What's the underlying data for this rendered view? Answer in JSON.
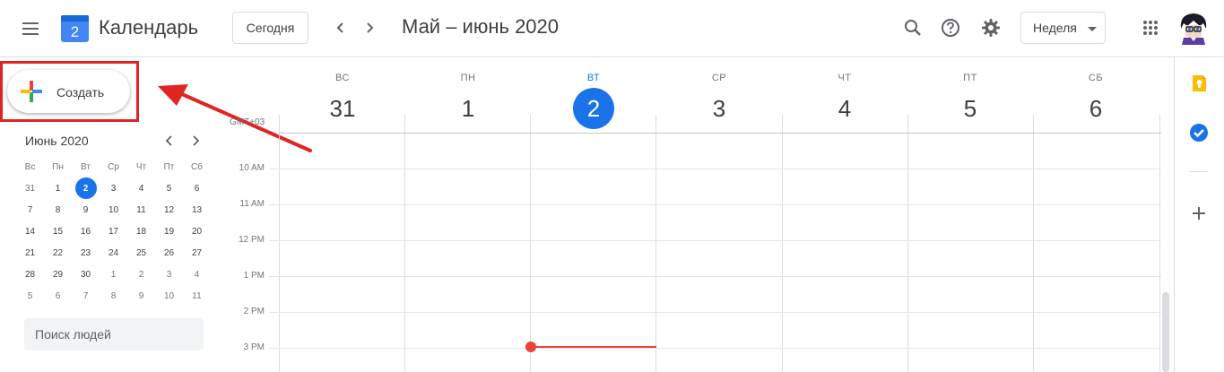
{
  "header": {
    "app_title": "Календарь",
    "logo_day": "2",
    "today_button": "Сегодня",
    "date_range": "Май – июнь 2020",
    "view_select": "Неделя"
  },
  "sidebar": {
    "create_label": "Создать",
    "mini_calendar": {
      "title": "Июнь 2020",
      "weekdays": [
        "Вс",
        "Пн",
        "Вт",
        "Ср",
        "Чт",
        "Пт",
        "Сб"
      ],
      "weeks": [
        [
          "31",
          "1",
          "2",
          "3",
          "4",
          "5",
          "6"
        ],
        [
          "7",
          "8",
          "9",
          "10",
          "11",
          "12",
          "13"
        ],
        [
          "14",
          "15",
          "16",
          "17",
          "18",
          "19",
          "20"
        ],
        [
          "21",
          "22",
          "23",
          "24",
          "25",
          "26",
          "27"
        ],
        [
          "28",
          "29",
          "30",
          "1",
          "2",
          "3",
          "4"
        ],
        [
          "5",
          "6",
          "7",
          "8",
          "9",
          "10",
          "11"
        ]
      ],
      "today": "2"
    },
    "people_search_placeholder": "Поиск людей"
  },
  "week": {
    "timezone": "GMT+03",
    "days": [
      {
        "dow": "ВС",
        "num": "31",
        "today": false
      },
      {
        "dow": "ПН",
        "num": "1",
        "today": false
      },
      {
        "dow": "ВТ",
        "num": "2",
        "today": true
      },
      {
        "dow": "СР",
        "num": "3",
        "today": false
      },
      {
        "dow": "ЧТ",
        "num": "4",
        "today": false
      },
      {
        "dow": "ПТ",
        "num": "5",
        "today": false
      },
      {
        "dow": "СБ",
        "num": "6",
        "today": false
      }
    ],
    "hours": [
      "10 AM",
      "11 AM",
      "12 PM",
      "1 PM",
      "2 PM",
      "3 PM"
    ]
  },
  "icons": {
    "menu": "hamburger-menu-icon",
    "search": "search-icon",
    "help": "help-icon",
    "settings": "gear-icon",
    "apps": "apps-grid-icon",
    "keep": "keep-icon",
    "tasks": "tasks-icon",
    "add": "plus-icon"
  },
  "colors": {
    "accent": "#1a73e8",
    "now_line": "#ea4335",
    "annotation": "#e02424"
  }
}
